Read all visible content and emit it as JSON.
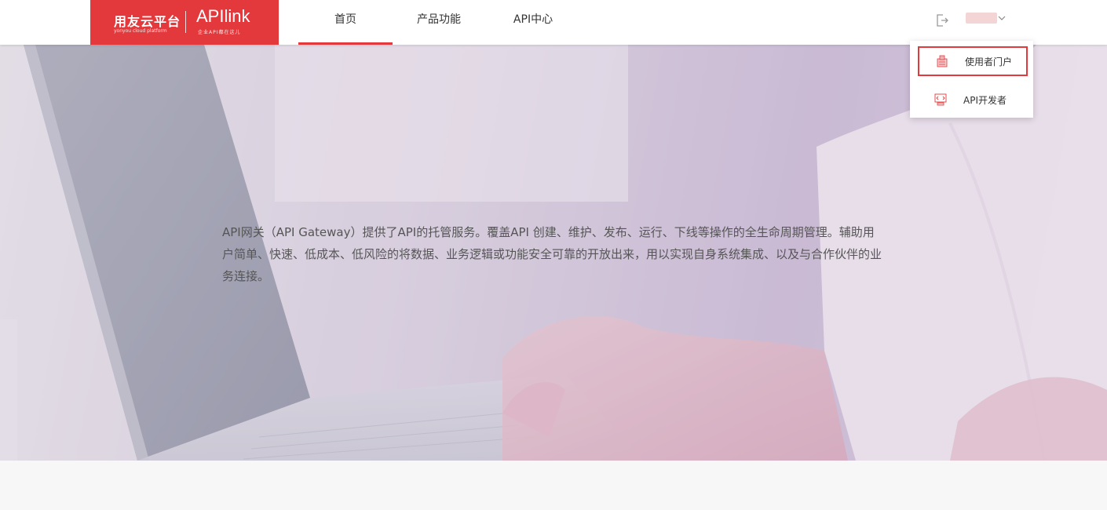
{
  "header": {
    "logo": {
      "brand": "用友云平台",
      "brand_sub": "yonyou cloud platform",
      "product": "APIlink",
      "product_sub": "企业API都在这儿"
    },
    "nav": [
      {
        "label": "首页",
        "active": true
      },
      {
        "label": "产品功能",
        "active": false
      },
      {
        "label": "API中心",
        "active": false
      }
    ],
    "logout_icon": "logout-icon",
    "chevron_icon": "chevron-down-icon"
  },
  "dropdown": {
    "items": [
      {
        "label": "使用者门户",
        "icon": "portal-icon",
        "highlighted": true
      },
      {
        "label": "API开发者",
        "icon": "developer-icon",
        "highlighted": false
      }
    ]
  },
  "hero": {
    "description": "API网关（API Gateway）提供了API的托管服务。覆盖API 创建、维护、发布、运行、下线等操作的全生命周期管理。辅助用户简单、快速、低成本、低风险的将数据、业务逻辑或功能安全可靠的开放出来，用以实现自身系统集成、以及与合作伙伴的业务连接。"
  },
  "colors": {
    "accent": "#e4393c",
    "text": "#333333",
    "hero_text": "#555555"
  }
}
